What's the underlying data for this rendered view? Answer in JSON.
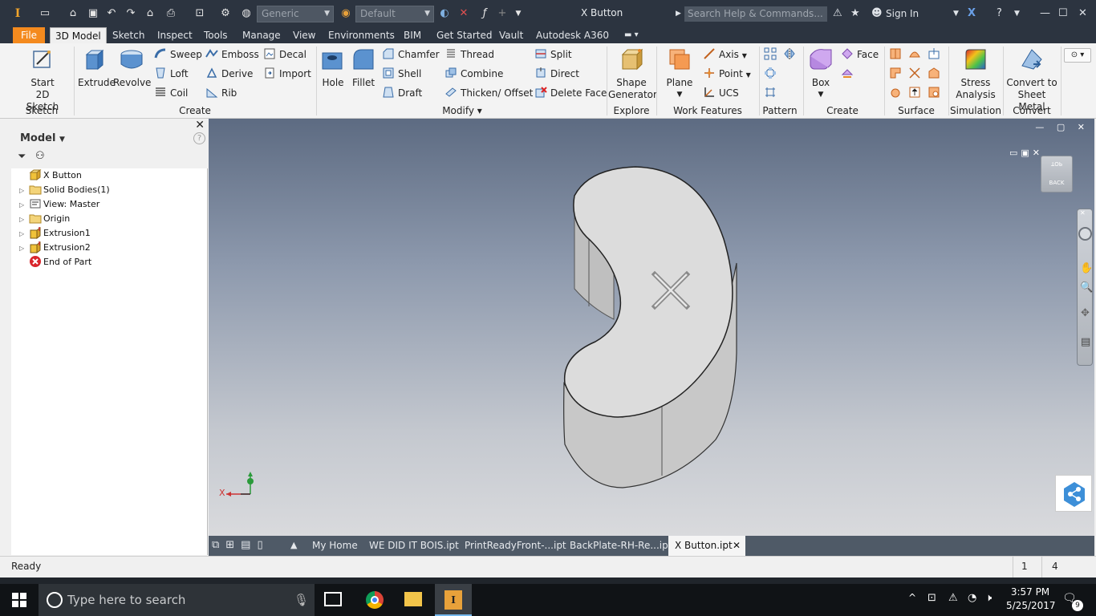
{
  "app": {
    "logo_text": "I",
    "window_title": "X Button",
    "appearance_dropdown": "Generic",
    "material_dropdown": "Default",
    "search_placeholder": "Search Help & Commands...",
    "sign_in": "Sign In"
  },
  "menu_tabs": [
    "File",
    "3D Model",
    "Sketch",
    "Inspect",
    "Tools",
    "Manage",
    "View",
    "Environments",
    "BIM",
    "Get Started",
    "Vault",
    "Autodesk A360"
  ],
  "ribbon": {
    "sketch": {
      "label": "Sketch",
      "start_sketch_line1": "Start",
      "start_sketch_line2": "2D Sketch"
    },
    "create": {
      "label": "Create",
      "extrude": "Extrude",
      "revolve": "Revolve",
      "sweep": "Sweep",
      "emboss": "Emboss",
      "decal": "Decal",
      "loft": "Loft",
      "derive": "Derive",
      "import": "Import",
      "coil": "Coil",
      "rib": "Rib"
    },
    "modify": {
      "label": "Modify ▾",
      "hole": "Hole",
      "fillet": "Fillet",
      "chamfer": "Chamfer",
      "thread": "Thread",
      "shell": "Shell",
      "combine": "Combine",
      "draft": "Draft",
      "thicken": "Thicken/ Offset",
      "split": "Split",
      "direct": "Direct",
      "delete_face": "Delete Face"
    },
    "explore": {
      "label": "Explore",
      "shape_gen_line1": "Shape",
      "shape_gen_line2": "Generator"
    },
    "work_features": {
      "label": "Work Features",
      "plane": "Plane",
      "axis": "Axis",
      "point": "Point",
      "ucs": "UCS"
    },
    "pattern": {
      "label": "Pattern"
    },
    "freeform": {
      "label": "Create Freeform",
      "box": "Box",
      "face": "Face"
    },
    "surface": {
      "label": "Surface"
    },
    "simulation": {
      "label": "Simulation",
      "stress_line1": "Stress",
      "stress_line2": "Analysis"
    },
    "convert": {
      "label": "Convert",
      "line1": "Convert to",
      "line2": "Sheet Metal"
    }
  },
  "browser": {
    "title": "Model",
    "items": [
      {
        "label": "X Button",
        "icon": "part-icon",
        "expandable": false
      },
      {
        "label": "Solid Bodies(1)",
        "icon": "folder-icon",
        "expandable": true
      },
      {
        "label": "View: Master",
        "icon": "view-icon",
        "expandable": true
      },
      {
        "label": "Origin",
        "icon": "folder-icon",
        "expandable": true
      },
      {
        "label": "Extrusion1",
        "icon": "extrusion-icon",
        "expandable": true
      },
      {
        "label": "Extrusion2",
        "icon": "extrusion-icon",
        "expandable": true
      },
      {
        "label": "End of Part",
        "icon": "end-of-part-icon",
        "expandable": false
      }
    ]
  },
  "viewport": {
    "viewcube_top": "TOP",
    "viewcube_back": "BACK",
    "emboss_text": "X",
    "triad_x": "X"
  },
  "doc_tabs": [
    "My Home",
    "WE DID IT BOIS.ipt",
    "PrintReadyFront-...ipt",
    "BackPlate-RH-Re...ipt",
    "X Button.ipt"
  ],
  "status": {
    "text": "Ready",
    "count1": "1",
    "count2": "4"
  },
  "taskbar": {
    "search_placeholder": "Type here to search",
    "time": "3:57 PM",
    "date": "5/25/2017",
    "notifications": "9"
  }
}
